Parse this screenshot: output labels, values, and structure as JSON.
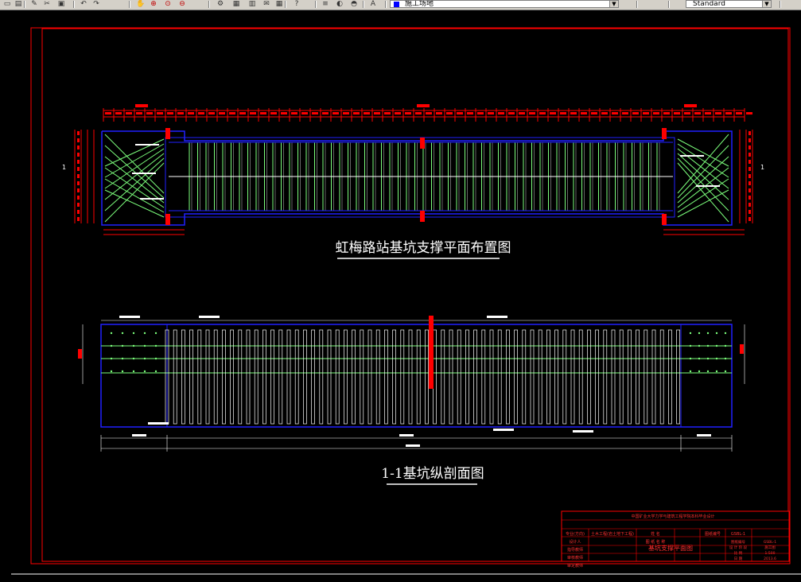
{
  "toolbar": {
    "layer_combo_value": "施工场地",
    "style_combo_value": "Standard",
    "icons": [
      "open-icon",
      "save-icon",
      "print-icon",
      "cut-icon",
      "copy-icon",
      "undo-icon",
      "redo-icon",
      "pan-icon",
      "zoom-realtime-icon",
      "zoom-window-icon",
      "zoom-previous-icon",
      "properties-icon",
      "design-center-icon",
      "tool-palette-icon",
      "markup-icon",
      "calculator-icon",
      "help-icon",
      "layer-manager-icon",
      "layer-state-icon",
      "layer-previous-icon",
      "text-style-icon"
    ]
  },
  "drawing": {
    "plan_title": "虹梅路站基坑支撑平面布置图",
    "section_title": "1-1基坑纵剖面图",
    "section_mark": "1",
    "colors": {
      "frame": "#ff0000",
      "outline": "#2020ff",
      "strut": "#7cff7c",
      "annotation": "#ffffff",
      "dimension": "#ff0000"
    }
  },
  "title_block": {
    "header": "中国矿业大学力学与建筑工程学院本科毕业设计",
    "row1": [
      "专业(方向)",
      "土木工程(岩土地下工程)",
      "姓 名",
      "",
      "图纸编号",
      "GSBL-1"
    ],
    "row2": [
      "设计人",
      "",
      "图 纸 名 称",
      "",
      "",
      ""
    ],
    "row3": [
      "指导教师",
      "",
      "",
      "",
      "",
      ""
    ],
    "row4": [
      "审核教师",
      "",
      "",
      "",
      "",
      ""
    ],
    "row5": [
      "审定教师",
      "",
      "",
      "",
      "",
      ""
    ],
    "drawing_name": "基坑支撑平面图",
    "right_labels": [
      "图纸编号",
      "设 计 阶 段",
      "比 例",
      "日 期"
    ],
    "right_values": [
      "GSBL-1",
      "施工图",
      "1:500",
      "2013.6"
    ]
  }
}
